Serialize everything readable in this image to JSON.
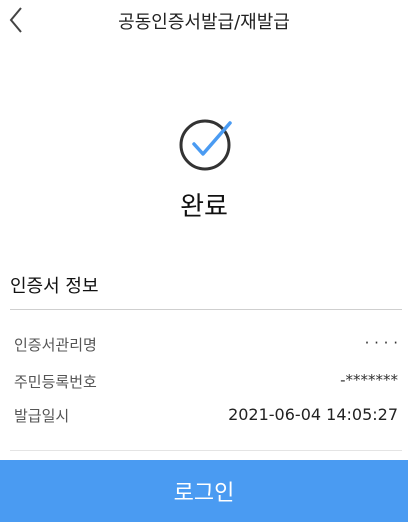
{
  "header": {
    "title": "공동인증서발급/재발급",
    "back_icon": "chevron-left-icon"
  },
  "status": {
    "icon": "check-circle-icon",
    "icon_color": "#4a9bf2",
    "label": "완료"
  },
  "section": {
    "title": "인증서 정보"
  },
  "info": {
    "cert_name_label": "인증서관리명",
    "cert_name_value": "· · · ·",
    "resident_number_label": "주민등록번호",
    "resident_number_value": "-*******",
    "issue_date_label": "발급일시",
    "issue_date_value": "2021-06-04 14:05:27"
  },
  "action": {
    "login_label": "로그인",
    "button_color": "#4a9bf2"
  }
}
